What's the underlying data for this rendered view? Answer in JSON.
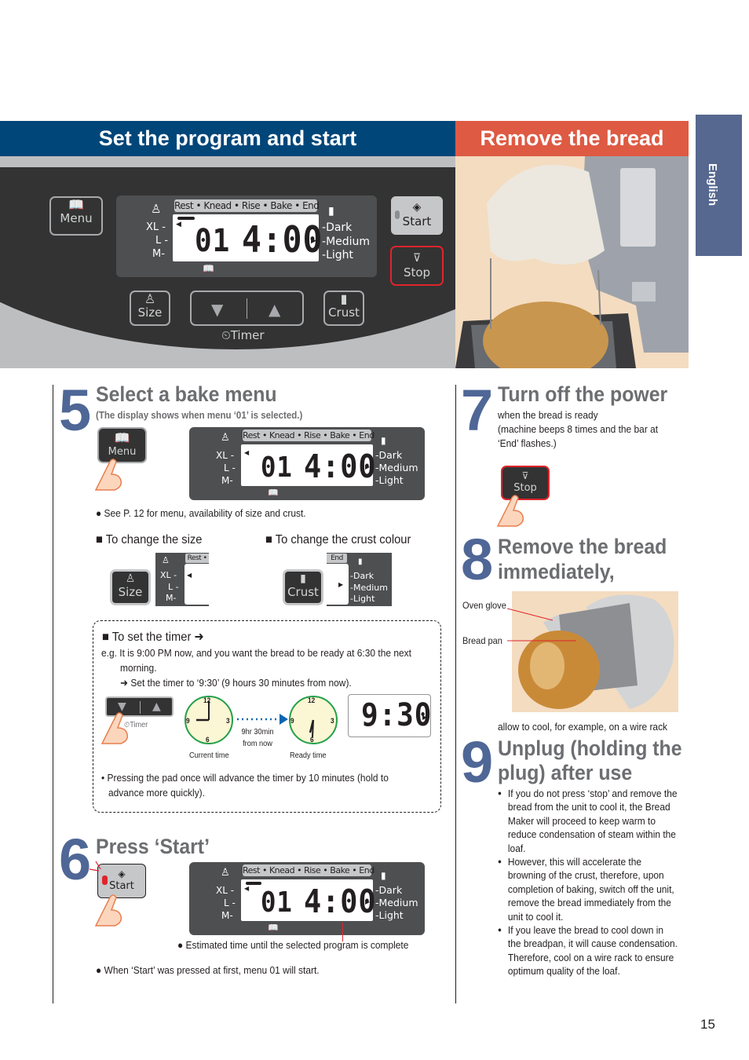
{
  "header": {
    "left_title": "Set the program and start",
    "right_title": "Remove the bread",
    "language_tab": "English"
  },
  "panel": {
    "menu_button": "Menu",
    "start_button": "Start",
    "stop_button": "Stop",
    "size_button": "Size",
    "crust_button": "Crust",
    "timer_label": "Timer",
    "timer_down_arrow": "▼",
    "timer_up_arrow": "▲",
    "stages": "Rest • Knead • Rise • Bake • End",
    "sizes": [
      "XL",
      "L",
      "M"
    ],
    "crust_levels": [
      "Dark",
      "Medium",
      "Light"
    ],
    "menu_number": "01",
    "time": "4:00",
    "icons": {
      "menu": "book-icon",
      "size": "weight-icon",
      "crust": "bread-icon",
      "start": "start-diamond-icon",
      "stop": "stop-triangle-icon",
      "timer": "clock-icon"
    }
  },
  "step5": {
    "number": "5",
    "title": "Select a bake menu",
    "subtitle": "(The display shows when menu ‘01’ is selected.)",
    "note": "See P. 12 for menu, availability of size and crust.",
    "change_size_label": "To change the size",
    "change_crust_label": "To change the crust colour",
    "size_stage_fragment": "Rest •",
    "crust_stage_fragment": "End",
    "timer_box": {
      "heading": "To set the timer ➜",
      "example_line1": "e.g. It is 9:00 PM now, and you want the bread to be ready at 6:30 the next",
      "example_line2": "morning.",
      "example_line3": "➜ Set the timer to ‘9:30’ (9 hours 30 minutes from now).",
      "current_time_label": "Current time",
      "ready_time_label": "Ready time",
      "interval_line1": "9hr 30min",
      "interval_line2": "from now",
      "clock_numbers": [
        "12",
        "3",
        "6",
        "9"
      ],
      "display_time": "9:30",
      "pad_note_line1": "• Pressing the pad once will advance the timer by 10 minutes (hold to",
      "pad_note_line2": "advance more quickly)."
    }
  },
  "step6": {
    "number": "6",
    "title": "Press ‘Start’",
    "estimated_note": "Estimated time until the selected program is complete",
    "first_start_note": "When ‘Start’ was pressed at first, menu 01 will start."
  },
  "step7": {
    "number": "7",
    "title": "Turn off the power",
    "line1": "when the bread is ready",
    "line2": "(machine beeps 8 times and the bar at",
    "line3": "‘End’ flashes.)"
  },
  "step8": {
    "number": "8",
    "title_line1": "Remove the bread",
    "title_line2": "immediately,",
    "label_glove": "Oven glove",
    "label_pan": "Bread pan",
    "caption": "allow to cool, for example, on a wire rack"
  },
  "step9": {
    "number": "9",
    "title_line1": "Unplug (holding the",
    "title_line2": "plug) after use",
    "bullets": [
      [
        "If you do not press ‘stop’ and remove the",
        "bread from the unit to cool it, the Bread",
        "Maker will proceed to keep warm to",
        "reduce condensation of steam within the",
        "loaf."
      ],
      [
        "However, this will accelerate the",
        "browning of the crust, therefore, upon",
        "completion of baking, switch off the unit,",
        "remove the bread immediately from the",
        "unit to cool it."
      ],
      [
        "If you leave the bread to cool down in",
        "the breadpan, it will cause condensation.",
        "Therefore, cool on a wire rack to ensure",
        "optimum quality of the loaf."
      ]
    ]
  },
  "page_number": "15",
  "colors": {
    "header_blue": "#004679",
    "header_red": "#de5a43",
    "lang_tab": "#56688f",
    "step_number": "#4f6796",
    "stop_outline": "#e0242b"
  }
}
